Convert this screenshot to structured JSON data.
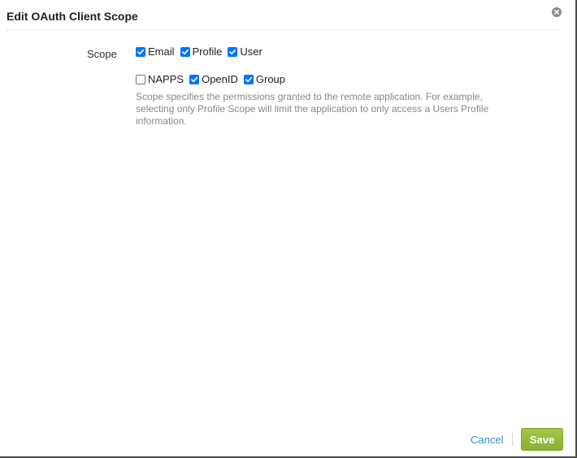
{
  "dialog": {
    "title": "Edit OAuth Client Scope",
    "close_icon": "close-circle-icon"
  },
  "scope": {
    "label": "Scope",
    "options": [
      {
        "label": "Email",
        "checked": true
      },
      {
        "label": "Profile",
        "checked": true
      },
      {
        "label": "User",
        "checked": true
      },
      {
        "label": "NAPPS",
        "checked": false
      },
      {
        "label": "OpenID",
        "checked": true
      },
      {
        "label": "Group",
        "checked": true
      }
    ],
    "help": "Scope specifies the permissions granted to the remote application. For example, selecting only Profile Scope will limit the application to only access a Users Profile information."
  },
  "footer": {
    "cancel_label": "Cancel",
    "save_label": "Save"
  },
  "colors": {
    "checkbox_accent": "#0075ff",
    "save_button": "#9bbd3f",
    "link": "#3a8ec9"
  }
}
